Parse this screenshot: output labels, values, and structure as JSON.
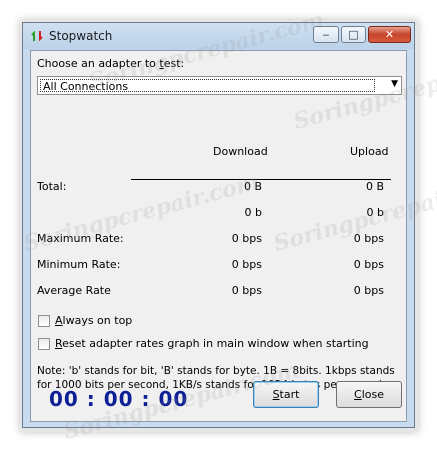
{
  "window": {
    "title": "Stopwatch",
    "minimize_glyph": "‒",
    "maximize_glyph": "□",
    "close_glyph": "✕"
  },
  "adapter": {
    "label_pre": "Choose an adapter to ",
    "label_acc": "t",
    "label_post": "est:",
    "selected": "All Connections"
  },
  "stats": {
    "headers": {
      "download": "Download",
      "upload": "Upload"
    },
    "rows": [
      {
        "label": "Total:",
        "download": "0 B",
        "upload": "0 B"
      },
      {
        "label": "",
        "download": "0 b",
        "upload": "0 b"
      },
      {
        "label": "Maximum Rate:",
        "download": "0 bps",
        "upload": "0 bps"
      },
      {
        "label": "Minimum Rate:",
        "download": "0 bps",
        "upload": "0 bps"
      },
      {
        "label": "Average Rate",
        "download": "0 bps",
        "upload": "0 bps"
      }
    ]
  },
  "options": {
    "always_on_top_acc": "A",
    "always_on_top_rest": "lways on top",
    "reset_acc": "R",
    "reset_rest": "eset adapter rates graph in main window when starting"
  },
  "note": "Note: 'b' stands for bit, 'B' stands for byte.  1B = 8bits.  1kbps stands for 1000 bits per second, 1KB/s stands for 1024 bytes per second.",
  "timer": "00 : 00 : 00",
  "buttons": {
    "start_acc": "S",
    "start_rest": "tart",
    "close_acc": "C",
    "close_rest": "lose"
  },
  "watermark": "Soringpcrepair.com"
}
